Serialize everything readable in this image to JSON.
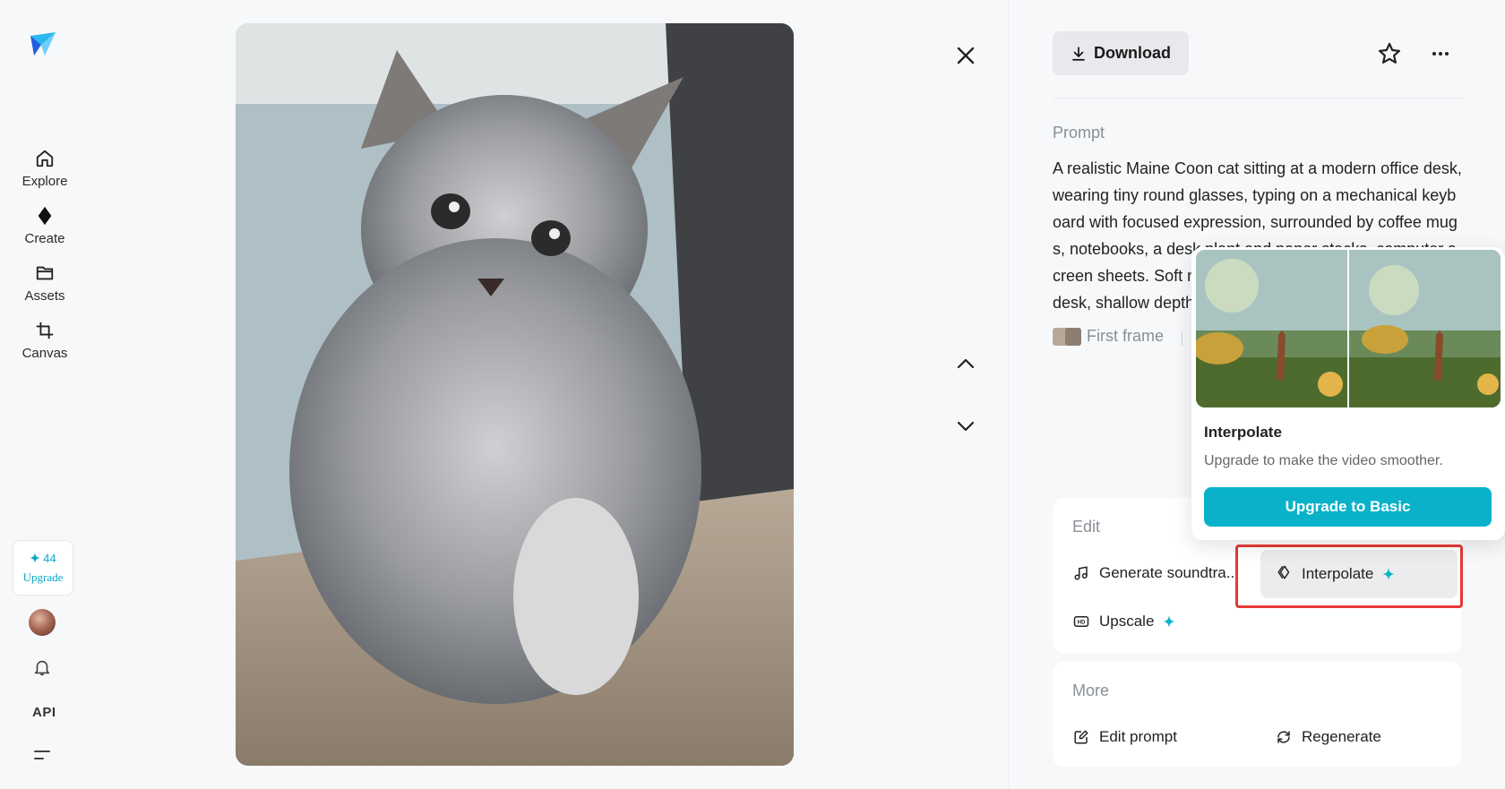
{
  "sidebar": {
    "items": [
      {
        "label": "Explore",
        "icon": "home-icon"
      },
      {
        "label": "Create",
        "icon": "diamond-icon"
      },
      {
        "label": "Assets",
        "icon": "folder-icon"
      },
      {
        "label": "Canvas",
        "icon": "crop-icon"
      }
    ],
    "credits": "44",
    "upgrade_label": "Upgrade",
    "api_label": "API"
  },
  "toolbar": {
    "download_label": "Download"
  },
  "prompt": {
    "label": "Prompt",
    "text": "A realistic Maine Coon cat sitting at a modern office desk, wearing tiny round glasses, typing on a mechanical keyboard with focused expression, surrounded by coffee mugs, notebooks, a desk plant and paper stacks, computer screen sheets. Soft natural light, cozy workspace, wooden desk, shallow depth of field",
    "first_frame_label": "First frame"
  },
  "edit": {
    "title": "Edit",
    "generate_soundtrack": "Generate soundtra...",
    "interpolate": "Interpolate",
    "upscale": "Upscale"
  },
  "more": {
    "title": "More",
    "edit_prompt": "Edit prompt",
    "regenerate": "Regenerate"
  },
  "popover": {
    "title": "Interpolate",
    "description": "Upgrade to make the video smoother.",
    "button": "Upgrade to Basic"
  },
  "colors": {
    "accent": "#0ab2c9",
    "highlight": "#e53935",
    "background": "#f7f8fa"
  }
}
